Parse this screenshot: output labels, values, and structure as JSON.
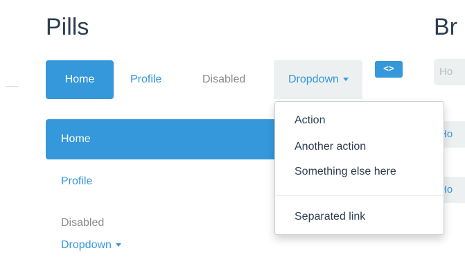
{
  "headings": {
    "pills": "Pills",
    "breadcrumbs_partial": "Br"
  },
  "top_pills": [
    {
      "label": "Home",
      "active": true
    },
    {
      "label": "Profile"
    },
    {
      "label": "Disabled",
      "disabled": true
    },
    {
      "label": "Dropdown",
      "open": true
    }
  ],
  "code_toggle_label": "<>",
  "dropdown_menu": {
    "items": [
      "Action",
      "Another action",
      "Something else here"
    ],
    "separated_item": "Separated link"
  },
  "stacked_pills": [
    {
      "label": "Home",
      "active": true
    },
    {
      "label": "Profile"
    },
    {
      "label": "Disabled",
      "disabled": true
    },
    {
      "label": "Dropdown"
    }
  ],
  "breadcrumb_fragments": [
    "Ho",
    "Ho",
    "Ho"
  ],
  "colors": {
    "accent": "#3498db",
    "heading": "#2c3e50",
    "muted": "#8a8a8a",
    "light_bg": "#ecf0f1"
  },
  "icons": {
    "caret": "caret-down-icon",
    "code": "code-icon"
  }
}
